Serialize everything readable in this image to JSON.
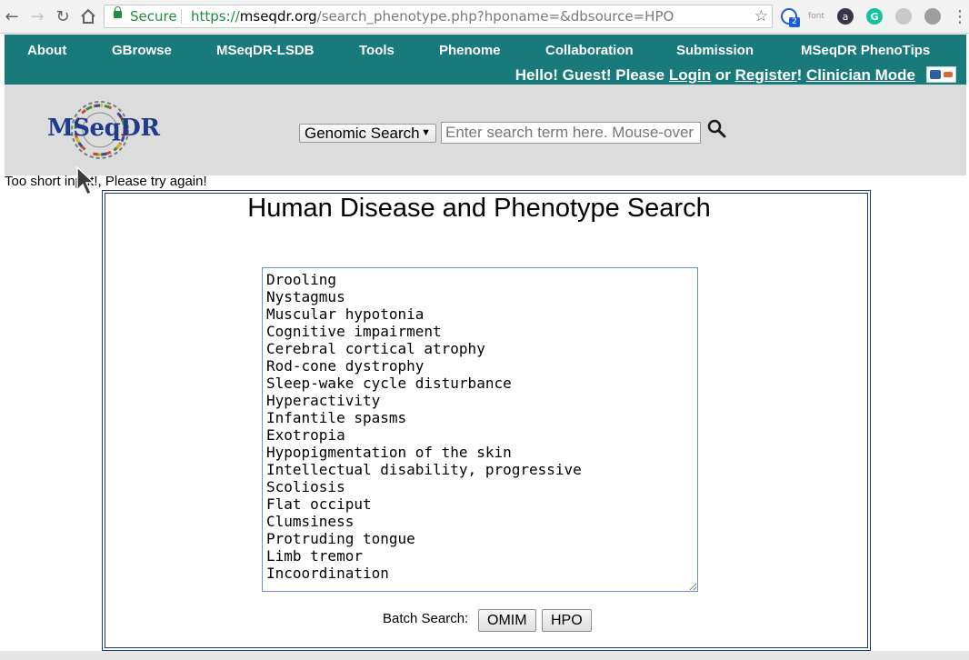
{
  "browser": {
    "secure_label": "Secure",
    "url_scheme": "https://",
    "url_host": "mseqdr.org",
    "url_path": "/search_phenotype.php?hponame=&dbsource=HPO",
    "extension_badge": "2",
    "extension_font_label": "font",
    "extension_a_label": "a",
    "extension_g_label": "G",
    "star_glyph": "☆",
    "menu_glyph": "⋮"
  },
  "nav": {
    "items": [
      "About",
      "GBrowse",
      "MSeqDR-LSDB",
      "Tools",
      "Phenome",
      "Collaboration",
      "Submission",
      "MSeqDR PhenoTips"
    ],
    "greeting_prefix": "Hello! Guest! Please",
    "login": "Login",
    "or": "or",
    "register": "Register",
    "exclaim": "!",
    "clinician_mode": "Clinician Mode"
  },
  "header": {
    "logo_text": "MSeqDR",
    "search_select_value": "Genomic Search",
    "search_placeholder": "Enter search term here. Mouse-over for"
  },
  "content": {
    "error_message": "Too short input!, Please try again!",
    "title": "Human Disease and Phenotype Search",
    "terms_value": "Drooling\nNystagmus\nMuscular hypotonia\nCognitive impairment\nCerebral cortical atrophy\nRod-cone dystrophy\nSleep-wake cycle disturbance\nHyperactivity\nInfantile spasms\nExotropia\nHypopigmentation of the skin\nIntellectual disability, progressive\nScoliosis\nFlat occiput\nClumsiness\nProtruding tongue\nLimb tremor\nIncoordination",
    "batch_label": "Batch Search:",
    "omim_button": "OMIM",
    "hpo_button": "HPO"
  },
  "colors": {
    "nav_background": "#187a7a",
    "header_background": "#dcdcdc",
    "panel_border": "#17397a",
    "secure_green": "#1e8e3e",
    "logo_navy": "#1f3c8c"
  }
}
